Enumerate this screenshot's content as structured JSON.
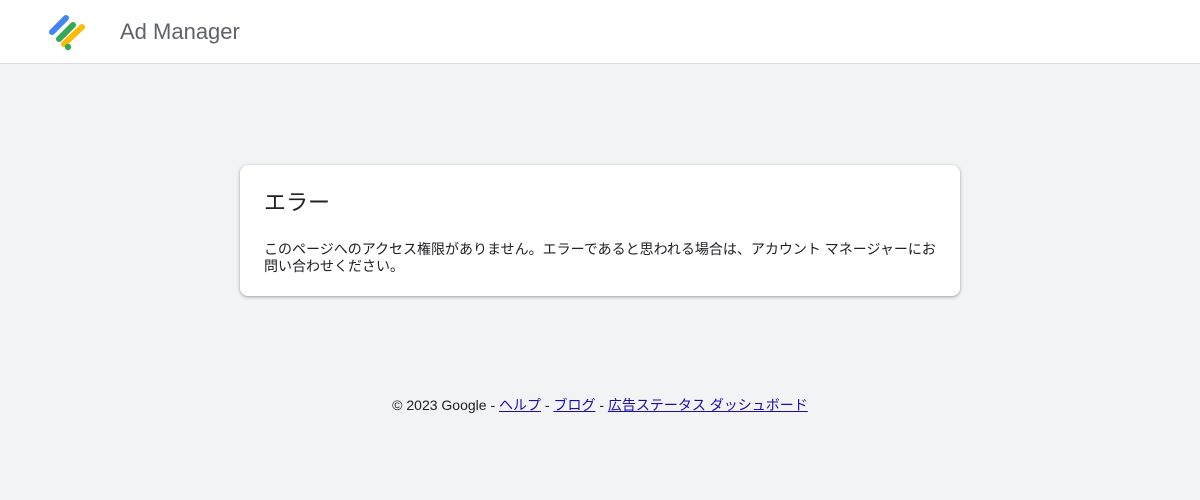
{
  "header": {
    "logo_icon": "ad-manager-logo-icon",
    "app_title": "Ad Manager"
  },
  "error_card": {
    "title": "エラー",
    "message": "このページへのアクセス権限がありません。エラーであると思われる場合は、アカウント マネージャーにお問い合わせください。"
  },
  "footer": {
    "copyright": "© 2023 Google",
    "separator": " - ",
    "links": [
      {
        "label": "ヘルプ"
      },
      {
        "label": "ブログ"
      },
      {
        "label": "広告ステータス ダッシュボード"
      }
    ]
  },
  "colors": {
    "background": "#f1f3f4",
    "link": "#1a0dab",
    "logo_blue": "#4285f4",
    "logo_yellow": "#fbbc04",
    "logo_green": "#34a853"
  }
}
